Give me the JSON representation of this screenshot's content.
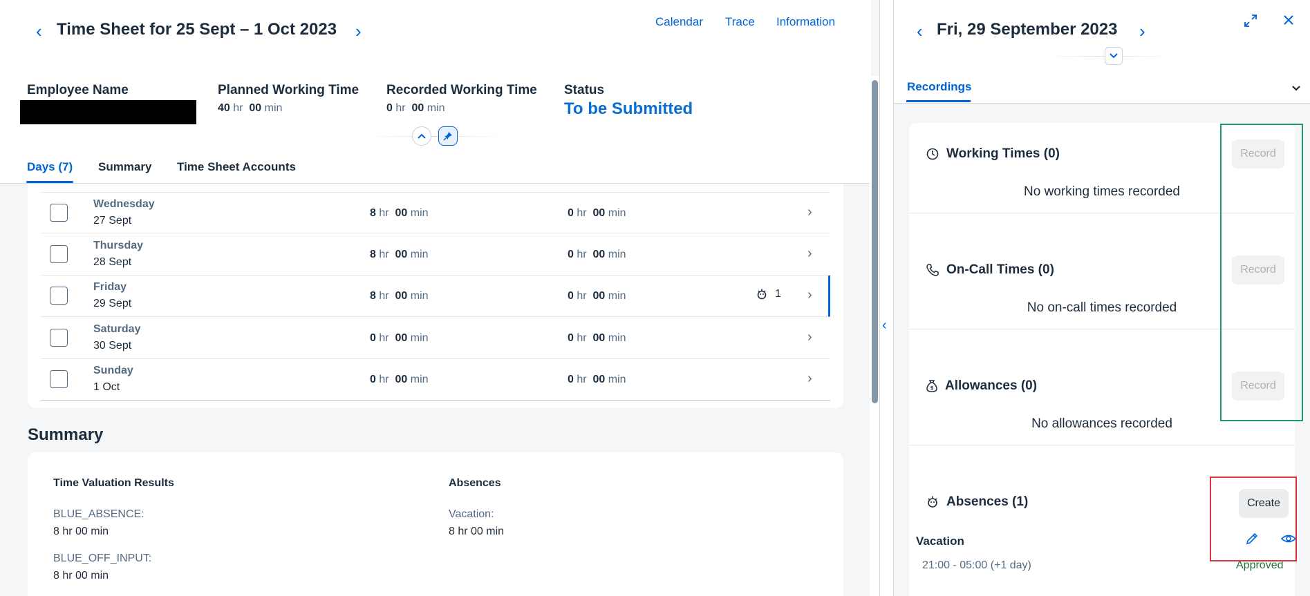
{
  "header": {
    "title": "Time Sheet for 25 Sept – 1 Oct 2023",
    "links": [
      "Calendar",
      "Trace",
      "Information"
    ],
    "employee_label": "Employee Name",
    "planned_label": "Planned Working Time",
    "planned_hr": "40",
    "planned_min": "00",
    "recorded_label": "Recorded Working Time",
    "recorded_hr": "0",
    "recorded_min": "00",
    "status_label": "Status",
    "status_value": "To be Submitted",
    "hr_unit": "hr",
    "min_unit": "min"
  },
  "tabs": [
    "Days (7)",
    "Summary",
    "Time Sheet Accounts"
  ],
  "days": [
    {
      "name": "Wednesday",
      "date": "27 Sept",
      "planned_hr": "8",
      "planned_min": "00",
      "rec_hr": "0",
      "rec_min": "00"
    },
    {
      "name": "Thursday",
      "date": "28 Sept",
      "planned_hr": "8",
      "planned_min": "00",
      "rec_hr": "0",
      "rec_min": "00"
    },
    {
      "name": "Friday",
      "date": "29 Sept",
      "planned_hr": "8",
      "planned_min": "00",
      "rec_hr": "0",
      "rec_min": "00",
      "absences": "1"
    },
    {
      "name": "Saturday",
      "date": "30 Sept",
      "planned_hr": "0",
      "planned_min": "00",
      "rec_hr": "0",
      "rec_min": "00"
    },
    {
      "name": "Sunday",
      "date": "1 Oct",
      "planned_hr": "0",
      "planned_min": "00",
      "rec_hr": "0",
      "rec_min": "00"
    }
  ],
  "summary": {
    "heading": "Summary",
    "valuation_heading": "Time Valuation Results",
    "absences_heading": "Absences",
    "valuation": [
      {
        "label": "BLUE_ABSENCE:",
        "value": "8 hr 00 min"
      },
      {
        "label": "BLUE_OFF_INPUT:",
        "value": "8 hr 00 min"
      }
    ],
    "absences": [
      {
        "label": "Vacation:",
        "value": "8 hr 00 min"
      }
    ]
  },
  "detail": {
    "title": "Fri, 29 September 2023",
    "tab": "Recordings",
    "sections": [
      {
        "title": "Working Times (0)",
        "empty": "No working times recorded",
        "button": "Record"
      },
      {
        "title": "On-Call Times (0)",
        "empty": "No on-call times recorded",
        "button": "Record"
      },
      {
        "title": "Allowances (0)",
        "empty": "No allowances recorded",
        "button": "Record"
      }
    ],
    "absences_title": "Absences (1)",
    "create_label": "Create",
    "absence_type": "Vacation",
    "absence_time": "21:00 - 05:00 (+1 day)",
    "absence_status": "Approved"
  },
  "colors": {
    "accent": "#0064d9",
    "status_blue": "#0a6ed1",
    "approved_green": "#256f3a",
    "highlight_green": "#1a9b6e",
    "highlight_red": "#e0323a"
  }
}
